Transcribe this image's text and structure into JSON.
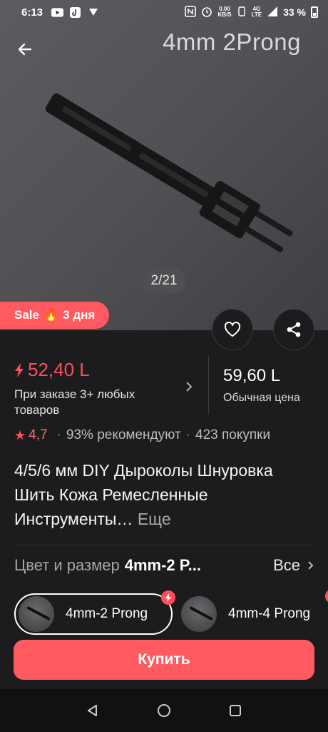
{
  "status_bar": {
    "time": "6:13",
    "network_speed_value": "0.00",
    "network_speed_unit": "KB/S",
    "network_type_top": "4G",
    "network_type_bottom": "LTE",
    "battery": "33 %",
    "icons": [
      "youtube-icon",
      "tiktok-icon",
      "vpn-icon",
      "nfc-icon",
      "alarm-icon",
      "vibrate-icon",
      "signal-icon",
      "battery-icon"
    ]
  },
  "hero": {
    "title": "4mm 2Prong",
    "counter": "2/21",
    "sale_label": "Sale",
    "sale_days": "3 дня"
  },
  "price": {
    "sale_price": "52,40 L",
    "sale_note": "При заказе 3+ любых товаров",
    "regular_price": "59,60 L",
    "regular_label": "Обычная цена"
  },
  "rating": {
    "value": "4,7",
    "recommend": "93% рекомендуют",
    "purchases": "423 покупки"
  },
  "product": {
    "title": "4/5/6 мм DIY Дыроколы Шнуровка Шить Кожа Ремесленные Инструменты…",
    "more": "Еще"
  },
  "variants": {
    "label": "Цвет и размер",
    "selected": "4mm-2 P...",
    "all": "Все",
    "options": [
      {
        "label": "4mm-2 Prong",
        "selected": true
      },
      {
        "label": "4mm-4 Prong",
        "selected": false
      }
    ]
  },
  "actions": {
    "buy": "Купить"
  },
  "colors": {
    "accent": "#ff5a5f",
    "background": "#1c1c1e",
    "price_red": "#ff4f5a"
  }
}
